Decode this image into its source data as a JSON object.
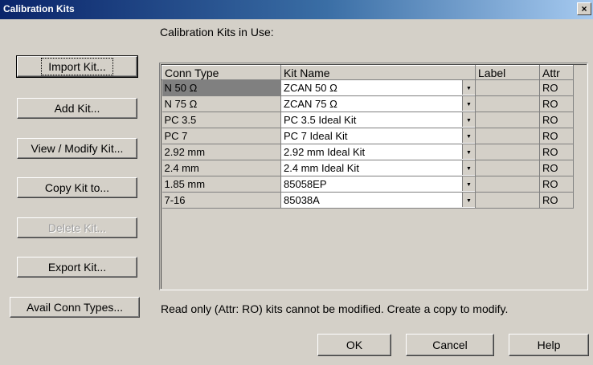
{
  "window": {
    "title": "Calibration Kits",
    "close_glyph": "×"
  },
  "section_label": "Calibration Kits in Use:",
  "buttons": {
    "import": "Import Kit...",
    "add": "Add Kit...",
    "view_modify": "View / Modify Kit...",
    "copy_to": "Copy Kit to...",
    "delete": "Delete Kit...",
    "export": "Export Kit...",
    "avail_conn": "Avail Conn Types..."
  },
  "table": {
    "columns": [
      "Conn Type",
      "Kit Name",
      "Label",
      "Attr"
    ],
    "rows": [
      {
        "conn": "N 50 Ω",
        "kit": "ZCAN 50 Ω",
        "label": "",
        "attr": "RO"
      },
      {
        "conn": "N 75 Ω",
        "kit": "ZCAN 75 Ω",
        "label": "",
        "attr": "RO"
      },
      {
        "conn": "PC 3.5",
        "kit": "PC 3.5 Ideal Kit",
        "label": "",
        "attr": "RO"
      },
      {
        "conn": "PC 7",
        "kit": "PC 7 Ideal Kit",
        "label": "",
        "attr": "RO"
      },
      {
        "conn": "2.92 mm",
        "kit": "2.92 mm Ideal Kit",
        "label": "",
        "attr": "RO"
      },
      {
        "conn": "2.4 mm",
        "kit": "2.4 mm Ideal Kit",
        "label": "",
        "attr": "RO"
      },
      {
        "conn": "1.85 mm",
        "kit": "85058EP",
        "label": "",
        "attr": "RO"
      },
      {
        "conn": "7-16",
        "kit": "85038A",
        "label": "",
        "attr": "RO"
      }
    ]
  },
  "note": "Read only (Attr: RO)  kits cannot be modified. Create a copy to modify.",
  "footer": {
    "ok": "OK",
    "cancel": "Cancel",
    "help": "Help"
  }
}
